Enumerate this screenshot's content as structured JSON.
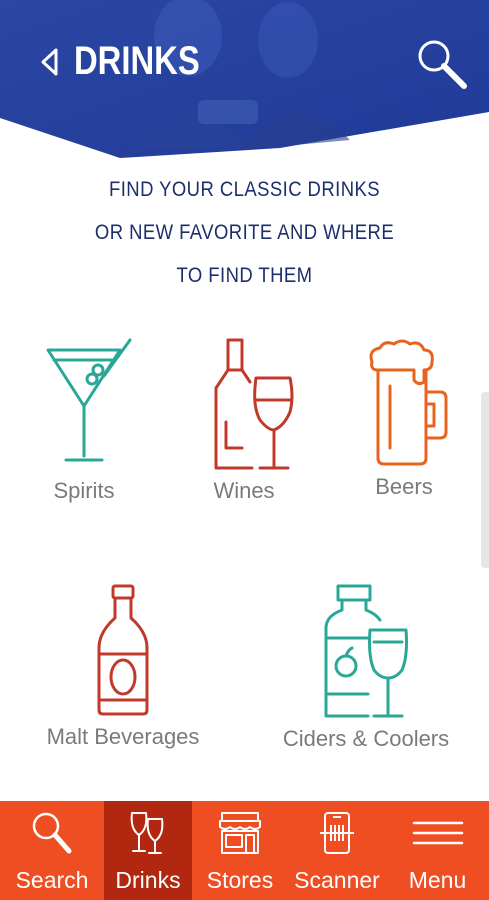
{
  "header": {
    "title": "DRINKS"
  },
  "tagline": [
    "FIND YOUR CLASSIC DRINKS",
    "OR NEW FAVORITE AND WHERE",
    "TO FIND THEM"
  ],
  "categories": [
    {
      "label": "Spirits",
      "icon": "martini-icon",
      "color": "#2aa897"
    },
    {
      "label": "Wines",
      "icon": "wine-bottle-glass-icon",
      "color": "#c0392b"
    },
    {
      "label": "Beers",
      "icon": "beer-mug-icon",
      "color": "#e8641e"
    },
    {
      "label": "Malt Beverages",
      "icon": "malt-bottle-icon",
      "color": "#c0392b"
    },
    {
      "label": "Ciders & Coolers",
      "icon": "cider-bottle-glass-icon",
      "color": "#2aa897"
    }
  ],
  "tabbar": {
    "items": [
      {
        "label": "Search",
        "icon": "search-icon"
      },
      {
        "label": "Drinks",
        "icon": "wine-glasses-icon"
      },
      {
        "label": "Stores",
        "icon": "storefront-icon"
      },
      {
        "label": "Scanner",
        "icon": "phone-scanner-icon"
      },
      {
        "label": "Menu",
        "icon": "hamburger-menu-icon"
      }
    ],
    "active": "Drinks",
    "color": "#ee4e22",
    "active_color": "#b2270f"
  },
  "colors": {
    "header_blue": "#2d49a5",
    "tagline_navy": "#1c2f6b"
  }
}
